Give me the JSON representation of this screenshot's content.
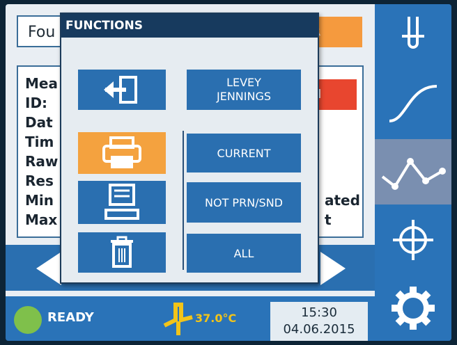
{
  "main": {
    "top_field": "Fou",
    "orange_tab": "R",
    "red_tab": "M",
    "detail_lines": [
      "Mea",
      "ID:",
      "Dat",
      "Tim",
      "Raw",
      "Res",
      "Min",
      "Max"
    ],
    "right_words": [
      "ated",
      "t"
    ]
  },
  "dialog": {
    "title": "FUNCTIONS",
    "levey_jennings": "LEVEY\nJENNINGS",
    "current": "CURRENT",
    "not_prn_snd": "NOT PRN/SND",
    "all": "ALL"
  },
  "status": {
    "ready": "READY",
    "temperature": "37.0°C",
    "time": "15:30",
    "date": "04.06.2015"
  },
  "sidebar": {
    "items": [
      "test-tube-icon",
      "curve-icon",
      "graph-icon",
      "crosshair-icon",
      "gear-icon"
    ]
  },
  "colors": {
    "accent": "#2a6fb0",
    "orange": "#f4a23f",
    "ready_green": "#7fc04b",
    "temp_yellow": "#f2c419"
  }
}
